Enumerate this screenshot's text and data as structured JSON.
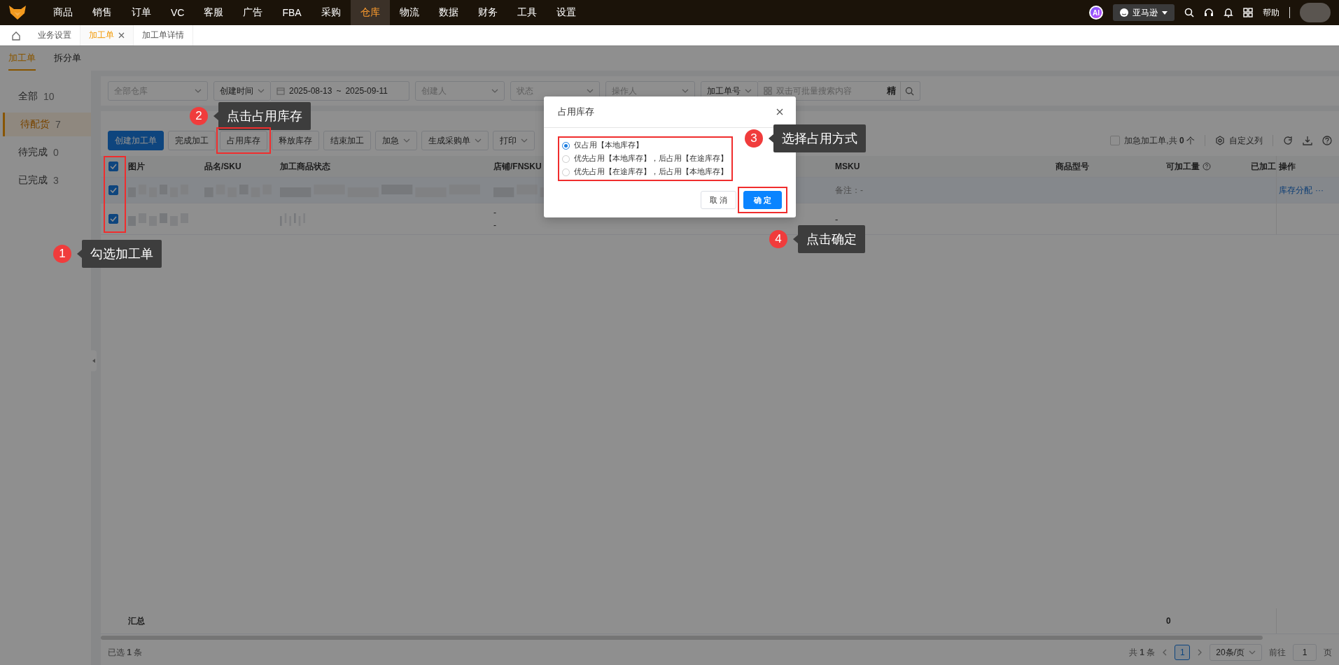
{
  "top_nav": {
    "items": [
      {
        "label": "商品",
        "selected": false
      },
      {
        "label": "销售",
        "selected": false
      },
      {
        "label": "订单",
        "selected": false
      },
      {
        "label": "VC",
        "selected": false
      },
      {
        "label": "客服",
        "selected": false
      },
      {
        "label": "广告",
        "selected": false
      },
      {
        "label": "FBA",
        "selected": false
      },
      {
        "label": "采购",
        "selected": false
      },
      {
        "label": "仓库",
        "selected": true
      },
      {
        "label": "物流",
        "selected": false
      },
      {
        "label": "数据",
        "selected": false
      },
      {
        "label": "财务",
        "selected": false
      },
      {
        "label": "工具",
        "selected": false
      },
      {
        "label": "设置",
        "selected": false
      }
    ],
    "ai_badge": "AI",
    "store": "亚马逊",
    "help": "帮助"
  },
  "page_tabs": [
    {
      "label": "业务设置",
      "selected": false,
      "closable": false
    },
    {
      "label": "加工单",
      "selected": true,
      "closable": true
    },
    {
      "label": "加工单详情",
      "selected": false,
      "closable": false
    }
  ],
  "sub_tabs": [
    {
      "label": "加工单",
      "selected": true
    },
    {
      "label": "拆分单",
      "selected": false
    }
  ],
  "sidebar": [
    {
      "label": "全部",
      "count": "10",
      "selected": false
    },
    {
      "label": "待配货",
      "count": "7",
      "selected": true
    },
    {
      "label": "待完成",
      "count": "0",
      "selected": false
    },
    {
      "label": "已完成",
      "count": "3",
      "selected": false
    }
  ],
  "filters": [
    {
      "kind": "select",
      "placeholder": "全部仓库"
    },
    {
      "kind": "select",
      "value": "创建时间"
    },
    {
      "kind": "daterange",
      "start": "2025-08-13",
      "separator": "~",
      "end": "2025-09-11"
    },
    {
      "kind": "select",
      "placeholder": "创建人"
    },
    {
      "kind": "select",
      "placeholder": "状态"
    },
    {
      "kind": "select",
      "placeholder": "操作人"
    },
    {
      "kind": "select",
      "value": "加工单号"
    },
    {
      "kind": "search",
      "placeholder": "双击可批量搜索内容",
      "exact_label": "精"
    }
  ],
  "toolbar": {
    "buttons": [
      {
        "label": "创建加工单",
        "kind": "primary",
        "highlighted": false
      },
      {
        "label": "完成加工",
        "kind": "default",
        "highlighted": false
      },
      {
        "label": "占用库存",
        "kind": "default",
        "highlighted": true
      },
      {
        "label": "释放库存",
        "kind": "default",
        "highlighted": false
      },
      {
        "label": "结束加工",
        "kind": "default",
        "highlighted": false
      },
      {
        "label": "加急",
        "kind": "dropdown",
        "highlighted": false
      },
      {
        "label": "生成采购单",
        "kind": "dropdown",
        "highlighted": false
      },
      {
        "label": "打印",
        "kind": "dropdown",
        "highlighted": false
      }
    ],
    "urgent_filter": {
      "label": "加急加工单,共 **0** 个",
      "checked": false
    },
    "custom_columns": "自定义列"
  },
  "table": {
    "all_checked": true,
    "select_column_highlighted": true,
    "columns": [
      "图片",
      "品名/SKU",
      "加工商品状态",
      "店铺/FNSKU",
      "MSKU",
      "商品型号",
      "可加工量",
      "已加工",
      "操作"
    ],
    "rows": [
      {
        "checked": true,
        "fnsku": [],
        "msku": "备注：-",
        "action": "库存分配",
        "more": "···"
      },
      {
        "checked": true,
        "fnsku": [
          "-",
          "-"
        ],
        "msku": "-"
      }
    ]
  },
  "summary": {
    "label": "汇总",
    "available": "0"
  },
  "footer": {
    "selected": "已选 **1** 条",
    "total": "共 **1** 条",
    "pages": [
      {
        "label": "1",
        "selected": true
      }
    ],
    "page_size": "20条/页",
    "goto_label": "前往",
    "goto_value": "1",
    "goto_suffix": "页"
  },
  "dialog": {
    "title": "占用库存",
    "options": [
      {
        "label": "仅占用【本地库存】",
        "selected": true
      },
      {
        "label": "优先占用【本地库存】，后占用【在途库存】",
        "selected": false
      },
      {
        "label": "优先占用【在途库存】，后占用【本地库存】",
        "selected": false
      }
    ],
    "options_highlighted": true,
    "cancel": "取 消",
    "confirm": "确 定",
    "confirm_highlighted": true
  },
  "callouts": [
    {
      "number": "1",
      "text": "勾选加工单"
    },
    {
      "number": "2",
      "text": "点击占用库存"
    },
    {
      "number": "3",
      "text": "选择占用方式"
    },
    {
      "number": "4",
      "text": "点击确定"
    }
  ]
}
